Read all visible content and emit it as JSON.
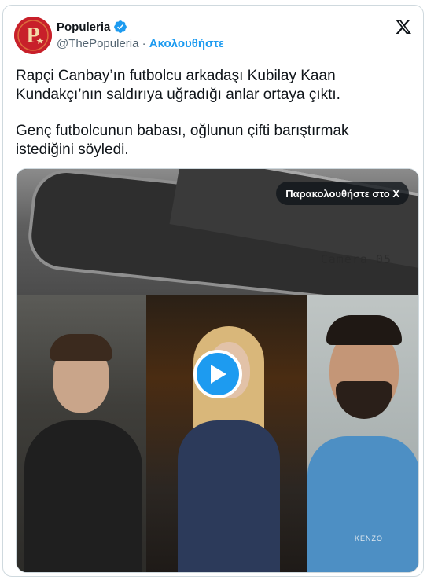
{
  "author": {
    "display_name": "Populeria",
    "handle": "@ThePopuleria",
    "separator": "·",
    "follow_label": "Ακολουθήστε",
    "avatar_letter": "P"
  },
  "tweet": {
    "paragraph1": "Rapçi Canbay’ın futbolcu arkadaşı Kubilay Kaan Kundakçı’nın saldırıya uğradığı anlar ortaya çıktı.",
    "paragraph2": "Genç futbolcunun babası, oğlunun çifti barıştırmak istediğini söyledi."
  },
  "media": {
    "watch_label": "Παρακολουθήστε στο X",
    "camera_label": "Camera 05",
    "shirt_label": "KENZO"
  },
  "colors": {
    "accent": "#1d9bf0",
    "text": "#0f1419",
    "muted": "#536471",
    "avatar_bg": "#c8202a"
  },
  "icons": [
    "verified-badge-icon",
    "x-logo-icon",
    "play-icon"
  ]
}
